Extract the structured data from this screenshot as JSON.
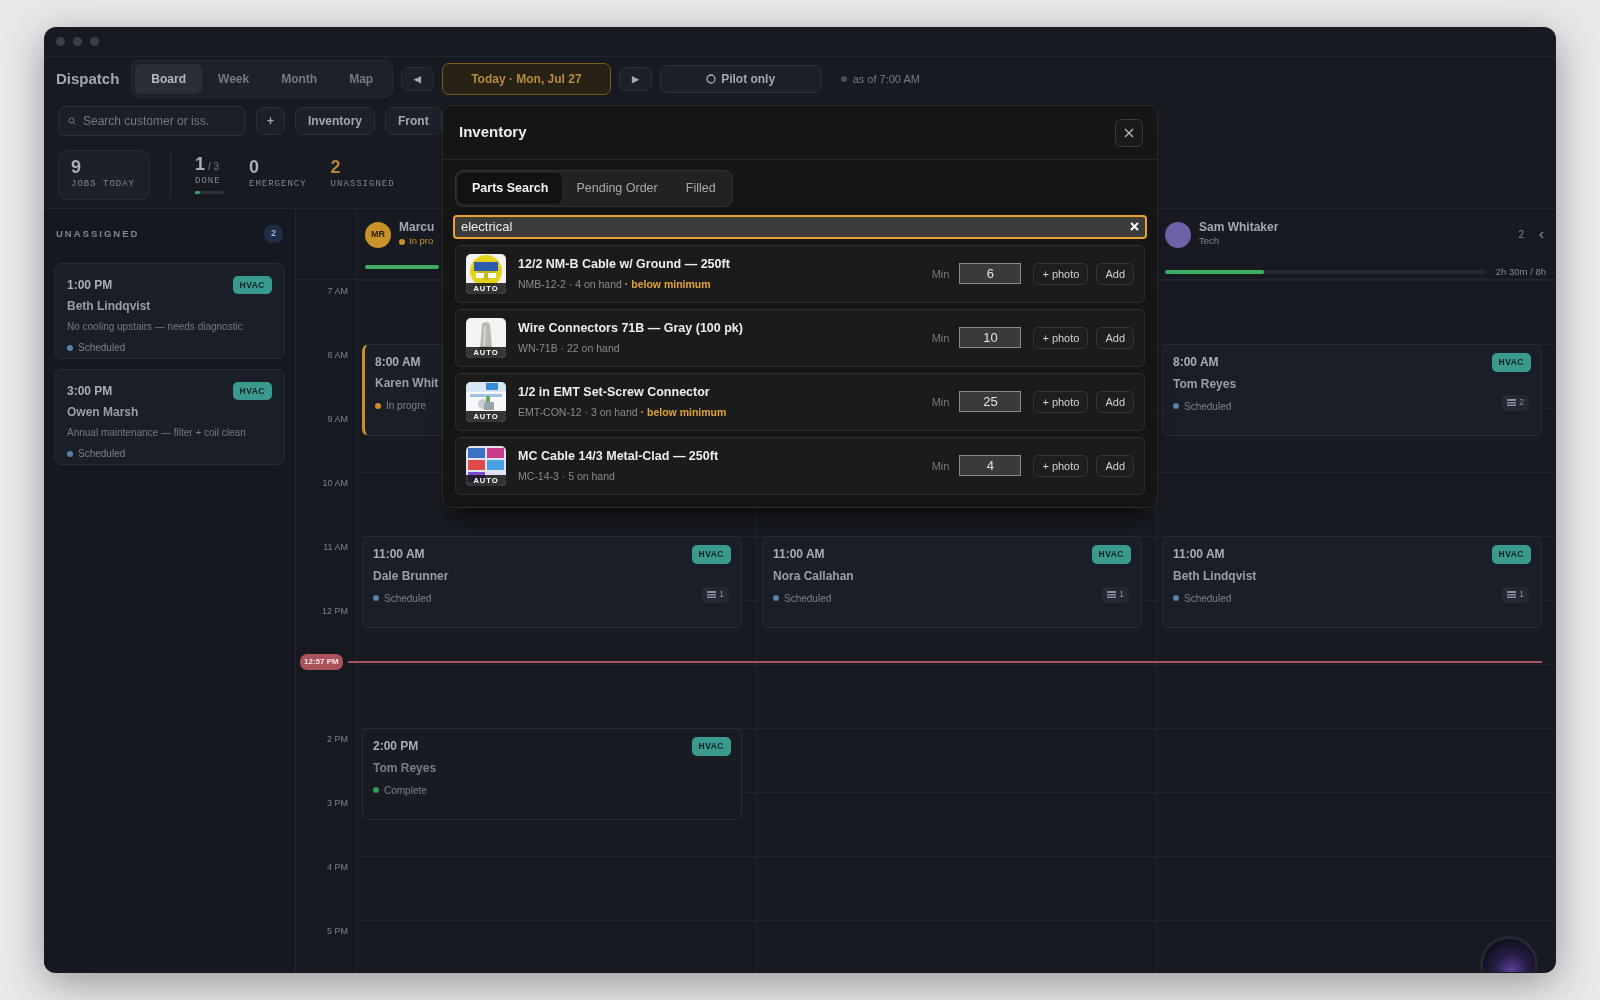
{
  "toolbar": {
    "title": "Dispatch",
    "views": [
      {
        "label": "Board",
        "selected": true
      },
      {
        "label": "Week",
        "selected": false
      },
      {
        "label": "Month",
        "selected": false
      },
      {
        "label": "Map",
        "selected": false
      }
    ],
    "prev": "◀",
    "date": "Today · Mon, Jul 27",
    "next": "▶",
    "pilot": "Pilot only",
    "as_of": "as of 7:00 AM",
    "search": {
      "placeholder": "Search customer or iss."
    },
    "add": "+",
    "buttons": [
      "Inventory",
      "Front"
    ]
  },
  "stats": [
    {
      "kind": "boxed",
      "value": "9",
      "label": "JOBS TODAY"
    },
    {
      "kind": "ratio",
      "value": "1",
      "of": "/ 3",
      "label": "DONE",
      "level": 0.15
    },
    {
      "kind": "plain",
      "value": "0",
      "label": "EMERGENCY"
    },
    {
      "kind": "warn",
      "value": "2",
      "label": "UNASSIGNED"
    }
  ],
  "unassigned": {
    "title": "UNASSIGNED",
    "count": "2",
    "jobs": [
      {
        "time": "1:00 PM",
        "tag": "HVAC",
        "customer": "Beth Lindqvist",
        "summary": "No cooling upstairs — needs diagnostic",
        "status": "Scheduled",
        "color": "#5b7fa8"
      },
      {
        "time": "3:00 PM",
        "tag": "HVAC",
        "customer": "Owen Marsh",
        "summary": "Annual maintenance — filter + coil clean",
        "status": "Scheduled",
        "color": "#5b7fa8"
      }
    ]
  },
  "board": {
    "hours": [
      "7 AM",
      "8 AM",
      "9 AM",
      "10 AM",
      "11 AM",
      "12 PM",
      "2 PM",
      "3 PM",
      "4 PM",
      "5 PM"
    ],
    "now": "12:57 PM",
    "columns": [
      {
        "tech": {
          "kind": "busy",
          "initials": "MR",
          "color": "#c8922a",
          "name": "Marcu",
          "subtitle": "In pro",
          "level": 1
        },
        "events": [
          {
            "kind": "active",
            "time": "8:00 AM",
            "customer": "Karen Whit",
            "status": "In progre",
            "color": "#d08a2a"
          },
          {
            "kind": "normal",
            "time": "11:00 AM",
            "tag": "HVAC",
            "customer": "Dale Brunner",
            "status": "Scheduled",
            "color": "#5b7fa8",
            "count": "1"
          },
          {
            "kind": "done",
            "time": "2:00 PM",
            "tag": "HVAC",
            "customer": "Tom Reyes",
            "status": "Complete",
            "color": "#2f9a55"
          }
        ]
      },
      {
        "events": [
          {
            "kind": "normal",
            "time": "11:00 AM",
            "tag": "HVAC",
            "customer": "Nora Callahan",
            "status": "Scheduled",
            "color": "#5b7fa8",
            "count": "1"
          }
        ]
      },
      {
        "tech": {
          "kind": "idle",
          "color": "#6e62a8",
          "name": "Sam Whitaker",
          "subtitle": "Tech",
          "jobs": "2",
          "level": 0.31,
          "utilization": "2h 30m / 8h"
        },
        "events": [
          {
            "kind": "normal",
            "time": "8:00 AM",
            "tag": "HVAC",
            "customer": "Tom Reyes",
            "status": "Scheduled",
            "color": "#5b7fa8",
            "count": "2"
          },
          {
            "kind": "normal",
            "time": "11:00 AM",
            "tag": "HVAC",
            "customer": "Beth Lindqvist",
            "status": "Scheduled",
            "color": "#5b7fa8",
            "count": "1"
          }
        ]
      }
    ]
  },
  "inventory_modal": {
    "title": "Inventory",
    "tabs": [
      {
        "label": "Parts Search",
        "selected": true
      },
      {
        "label": "Pending Order",
        "selected": false
      },
      {
        "label": "Filled",
        "selected": false
      }
    ],
    "search": {
      "value": "electrical"
    },
    "parts": [
      {
        "name": "12/2 NM-B Cable w/ Ground — 250ft",
        "badge": "AUTO",
        "meta": "NMB-12-2 · 4 on hand",
        "warning": "· below minimum",
        "min_label": "Min",
        "min": "6",
        "photo": "+ photo",
        "add": "Add"
      },
      {
        "name": "Wire Connectors 71B — Gray (100 pk)",
        "badge": "AUTO",
        "meta": "WN-71B · 22 on hand",
        "min_label": "Min",
        "min": "10",
        "photo": "+ photo",
        "add": "Add"
      },
      {
        "name": "1/2 in EMT Set-Screw Connector",
        "badge": "AUTO",
        "meta": "EMT-CON-12 · 3 on hand",
        "warning": "· below minimum",
        "min_label": "Min",
        "min": "25",
        "photo": "+ photo",
        "add": "Add"
      },
      {
        "name": "MC Cable 14/3 Metal-Clad — 250ft",
        "badge": "AUTO",
        "meta": "MC-14-3 · 5 on hand",
        "min_label": "Min",
        "min": "4",
        "photo": "+ photo",
        "add": "Add"
      }
    ]
  }
}
